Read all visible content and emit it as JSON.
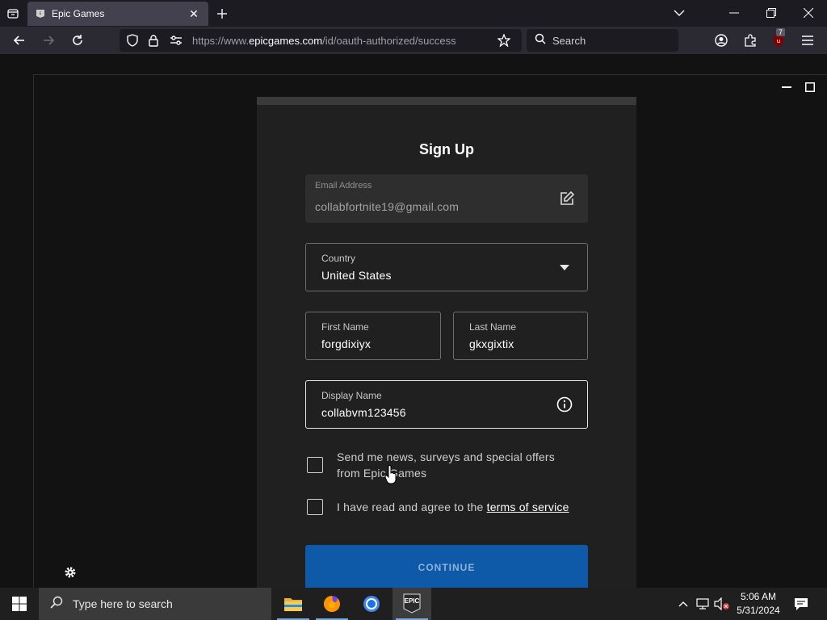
{
  "browser": {
    "tab_title": "Epic Games",
    "url_prefix": "https://www.",
    "url_domain": "epicgames.com",
    "url_path": "/id/oauth-authorized/success",
    "search_placeholder": "Search",
    "extension_badge": "7"
  },
  "form": {
    "title": "Sign Up",
    "email": {
      "label": "Email Address",
      "value": "collabfortnite19@gmail.com"
    },
    "country": {
      "label": "Country",
      "value": "United States"
    },
    "first_name": {
      "label": "First Name",
      "value": "forgdixiyx"
    },
    "last_name": {
      "label": "Last Name",
      "value": "gkxgixtix"
    },
    "display_name": {
      "label": "Display Name",
      "value": "collabvm123456"
    },
    "news_checkbox_line1": "Send me news, surveys and special offers",
    "news_checkbox_line2": "from Epic Games",
    "tos_prefix": "I have read and agree to the ",
    "tos_link": "terms of service",
    "continue_label": "CONTINUE"
  },
  "taskbar": {
    "search_placeholder": "Type here to search",
    "time": "5:06 AM",
    "date": "5/31/2024",
    "epic_icon_label": "EPIC"
  },
  "colors": {
    "accent": "#0e5aa8",
    "background": "#121212",
    "card": "#202020"
  }
}
